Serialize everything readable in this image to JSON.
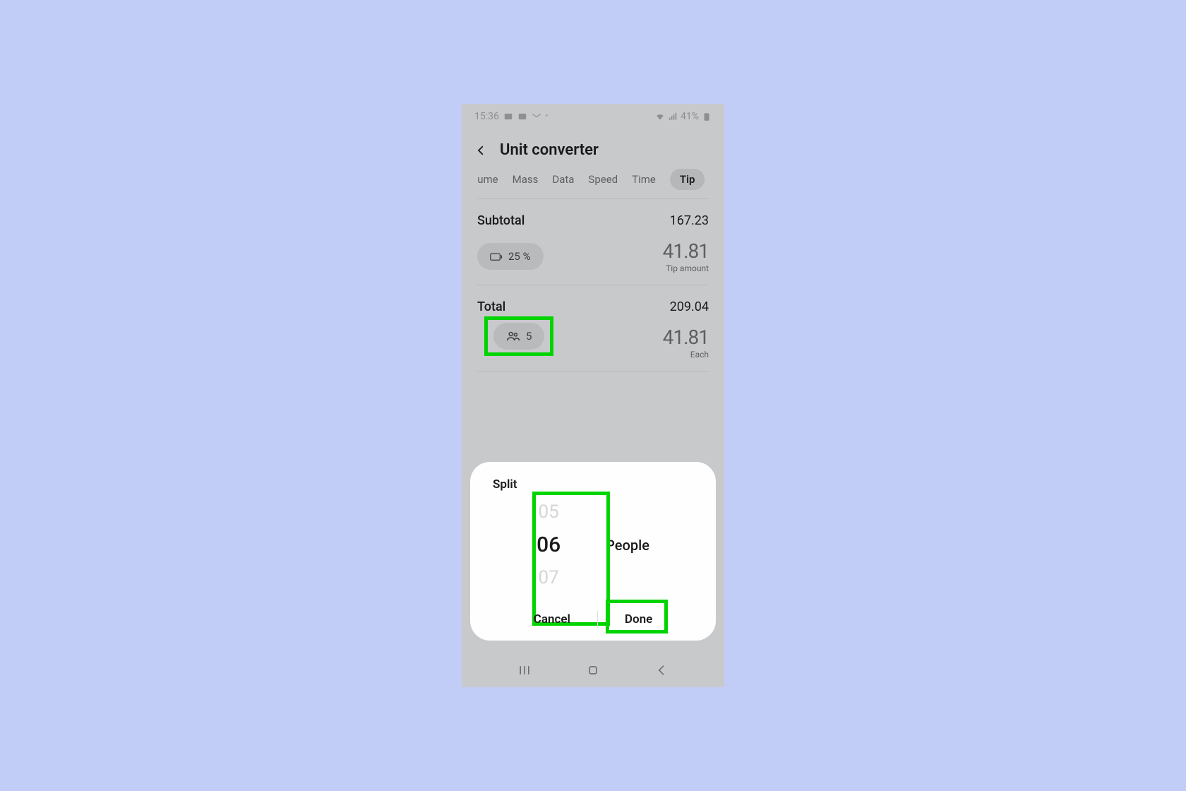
{
  "status": {
    "time": "15:36",
    "battery": "41%"
  },
  "header": {
    "title": "Unit converter"
  },
  "tabs": {
    "t0": "olume",
    "t1": "Mass",
    "t2": "Data",
    "t3": "Speed",
    "t4": "Time",
    "t5": "Tip"
  },
  "subtotal": {
    "label": "Subtotal",
    "value": "167.23"
  },
  "tip": {
    "chip": "25 %",
    "amount": "41.81",
    "sub": "Tip amount"
  },
  "total": {
    "label": "Total",
    "value": "209.04"
  },
  "each": {
    "chip": "5",
    "amount": "41.81",
    "sub": "Each"
  },
  "modal": {
    "title": "Split",
    "prev": "05",
    "selected": "06",
    "next": "07",
    "peopleLabel": "People",
    "cancel": "Cancel",
    "done": "Done"
  }
}
